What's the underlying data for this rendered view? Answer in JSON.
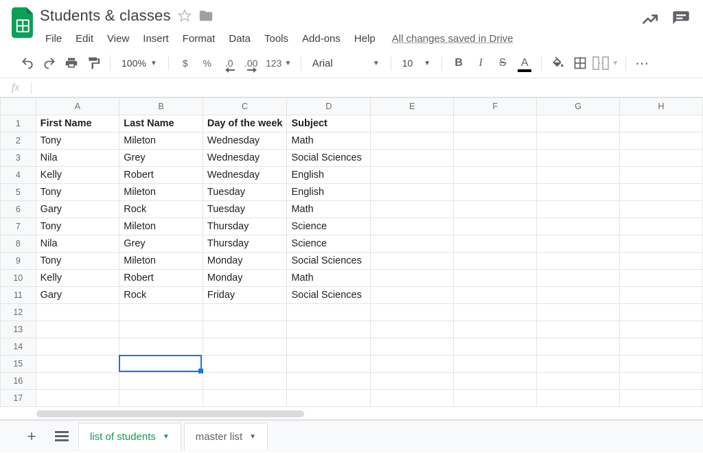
{
  "doc": {
    "title": "Students & classes",
    "drive_status": "All changes saved in Drive"
  },
  "menubar": [
    "File",
    "Edit",
    "View",
    "Insert",
    "Format",
    "Data",
    "Tools",
    "Add-ons",
    "Help"
  ],
  "toolbar": {
    "zoom": "100%",
    "currency": "$",
    "percent": "%",
    "dec_dec": ".0",
    "inc_dec": ".00",
    "numfmt": "123",
    "font": "Arial",
    "size": "10",
    "bold": "B",
    "italic": "I",
    "strike": "S",
    "textcolor": "A",
    "more": "⋯"
  },
  "fx": {
    "value": ""
  },
  "columns": [
    "A",
    "B",
    "C",
    "D",
    "E",
    "F",
    "G",
    "H"
  ],
  "row_count": 17,
  "headers": [
    "First Name",
    "Last Name",
    "Day of the week",
    "Subject"
  ],
  "rows": [
    [
      "Tony",
      "Mileton",
      "Wednesday",
      "Math"
    ],
    [
      "Nila",
      "Grey",
      "Wednesday",
      "Social Sciences"
    ],
    [
      "Kelly",
      "Robert",
      "Wednesday",
      "English"
    ],
    [
      "Tony",
      "Mileton",
      "Tuesday",
      "English"
    ],
    [
      "Gary",
      "Rock",
      "Tuesday",
      "Math"
    ],
    [
      "Tony",
      "Mileton",
      "Thursday",
      "Science"
    ],
    [
      "Nila",
      "Grey",
      "Thursday",
      "Science"
    ],
    [
      "Tony",
      "Mileton",
      "Monday",
      "Social Sciences"
    ],
    [
      "Kelly",
      "Robert",
      "Monday",
      "Math"
    ],
    [
      "Gary",
      "Rock",
      "Friday",
      "Social Sciences"
    ]
  ],
  "selection": {
    "col": "B",
    "row": 15
  },
  "sheets": {
    "active": "list of students",
    "other": "master list"
  }
}
